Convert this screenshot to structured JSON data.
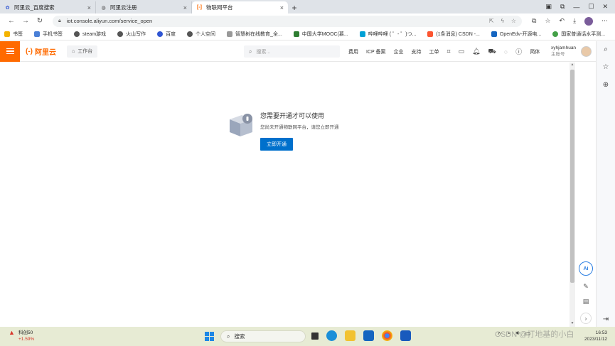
{
  "browser": {
    "tabs": [
      {
        "title": "阿里云_百度搜索",
        "active": false
      },
      {
        "title": "阿里云注册",
        "active": false
      },
      {
        "title": "物联网平台",
        "active": true
      }
    ],
    "url": "iot.console.aliyun.com/service_open",
    "bookmarks": [
      "书签",
      "手机书签",
      "steam游戏",
      "火山写作",
      "百度",
      "个人空间",
      "智慧树在线教育_全...",
      "中国大学MOOC(慕...",
      "哔哩哔哩 ( ゜- ゜)つ...",
      "(1条消息) CSDN -...",
      "OpenEdv-开源电...",
      "国家普通话水平测..."
    ]
  },
  "header": {
    "logo_mark": "(-)",
    "logo_text": "阿里云",
    "workbench": "工作台",
    "search_placeholder": "搜索...",
    "nav": [
      "费用",
      "ICP 备案",
      "企业",
      "支持",
      "工单"
    ],
    "lang": "简体",
    "username": "xyhjamhuan",
    "role": "主账号"
  },
  "main": {
    "title": "您需要开通才可以使用",
    "description": "您尚未开通物联网平台，请您立即开通",
    "button": "立即开通"
  },
  "floating": {
    "ai": "Ai"
  },
  "taskbar": {
    "stock_name": "科创50",
    "stock_change": "+1.59%",
    "search": "搜索",
    "clock_time": "16:53",
    "clock_date": "2023/11/12"
  },
  "watermark": "CSDN @打地基的小白",
  "colors": {
    "brand": "#ff6a00",
    "primary_button": "#0070cc"
  }
}
